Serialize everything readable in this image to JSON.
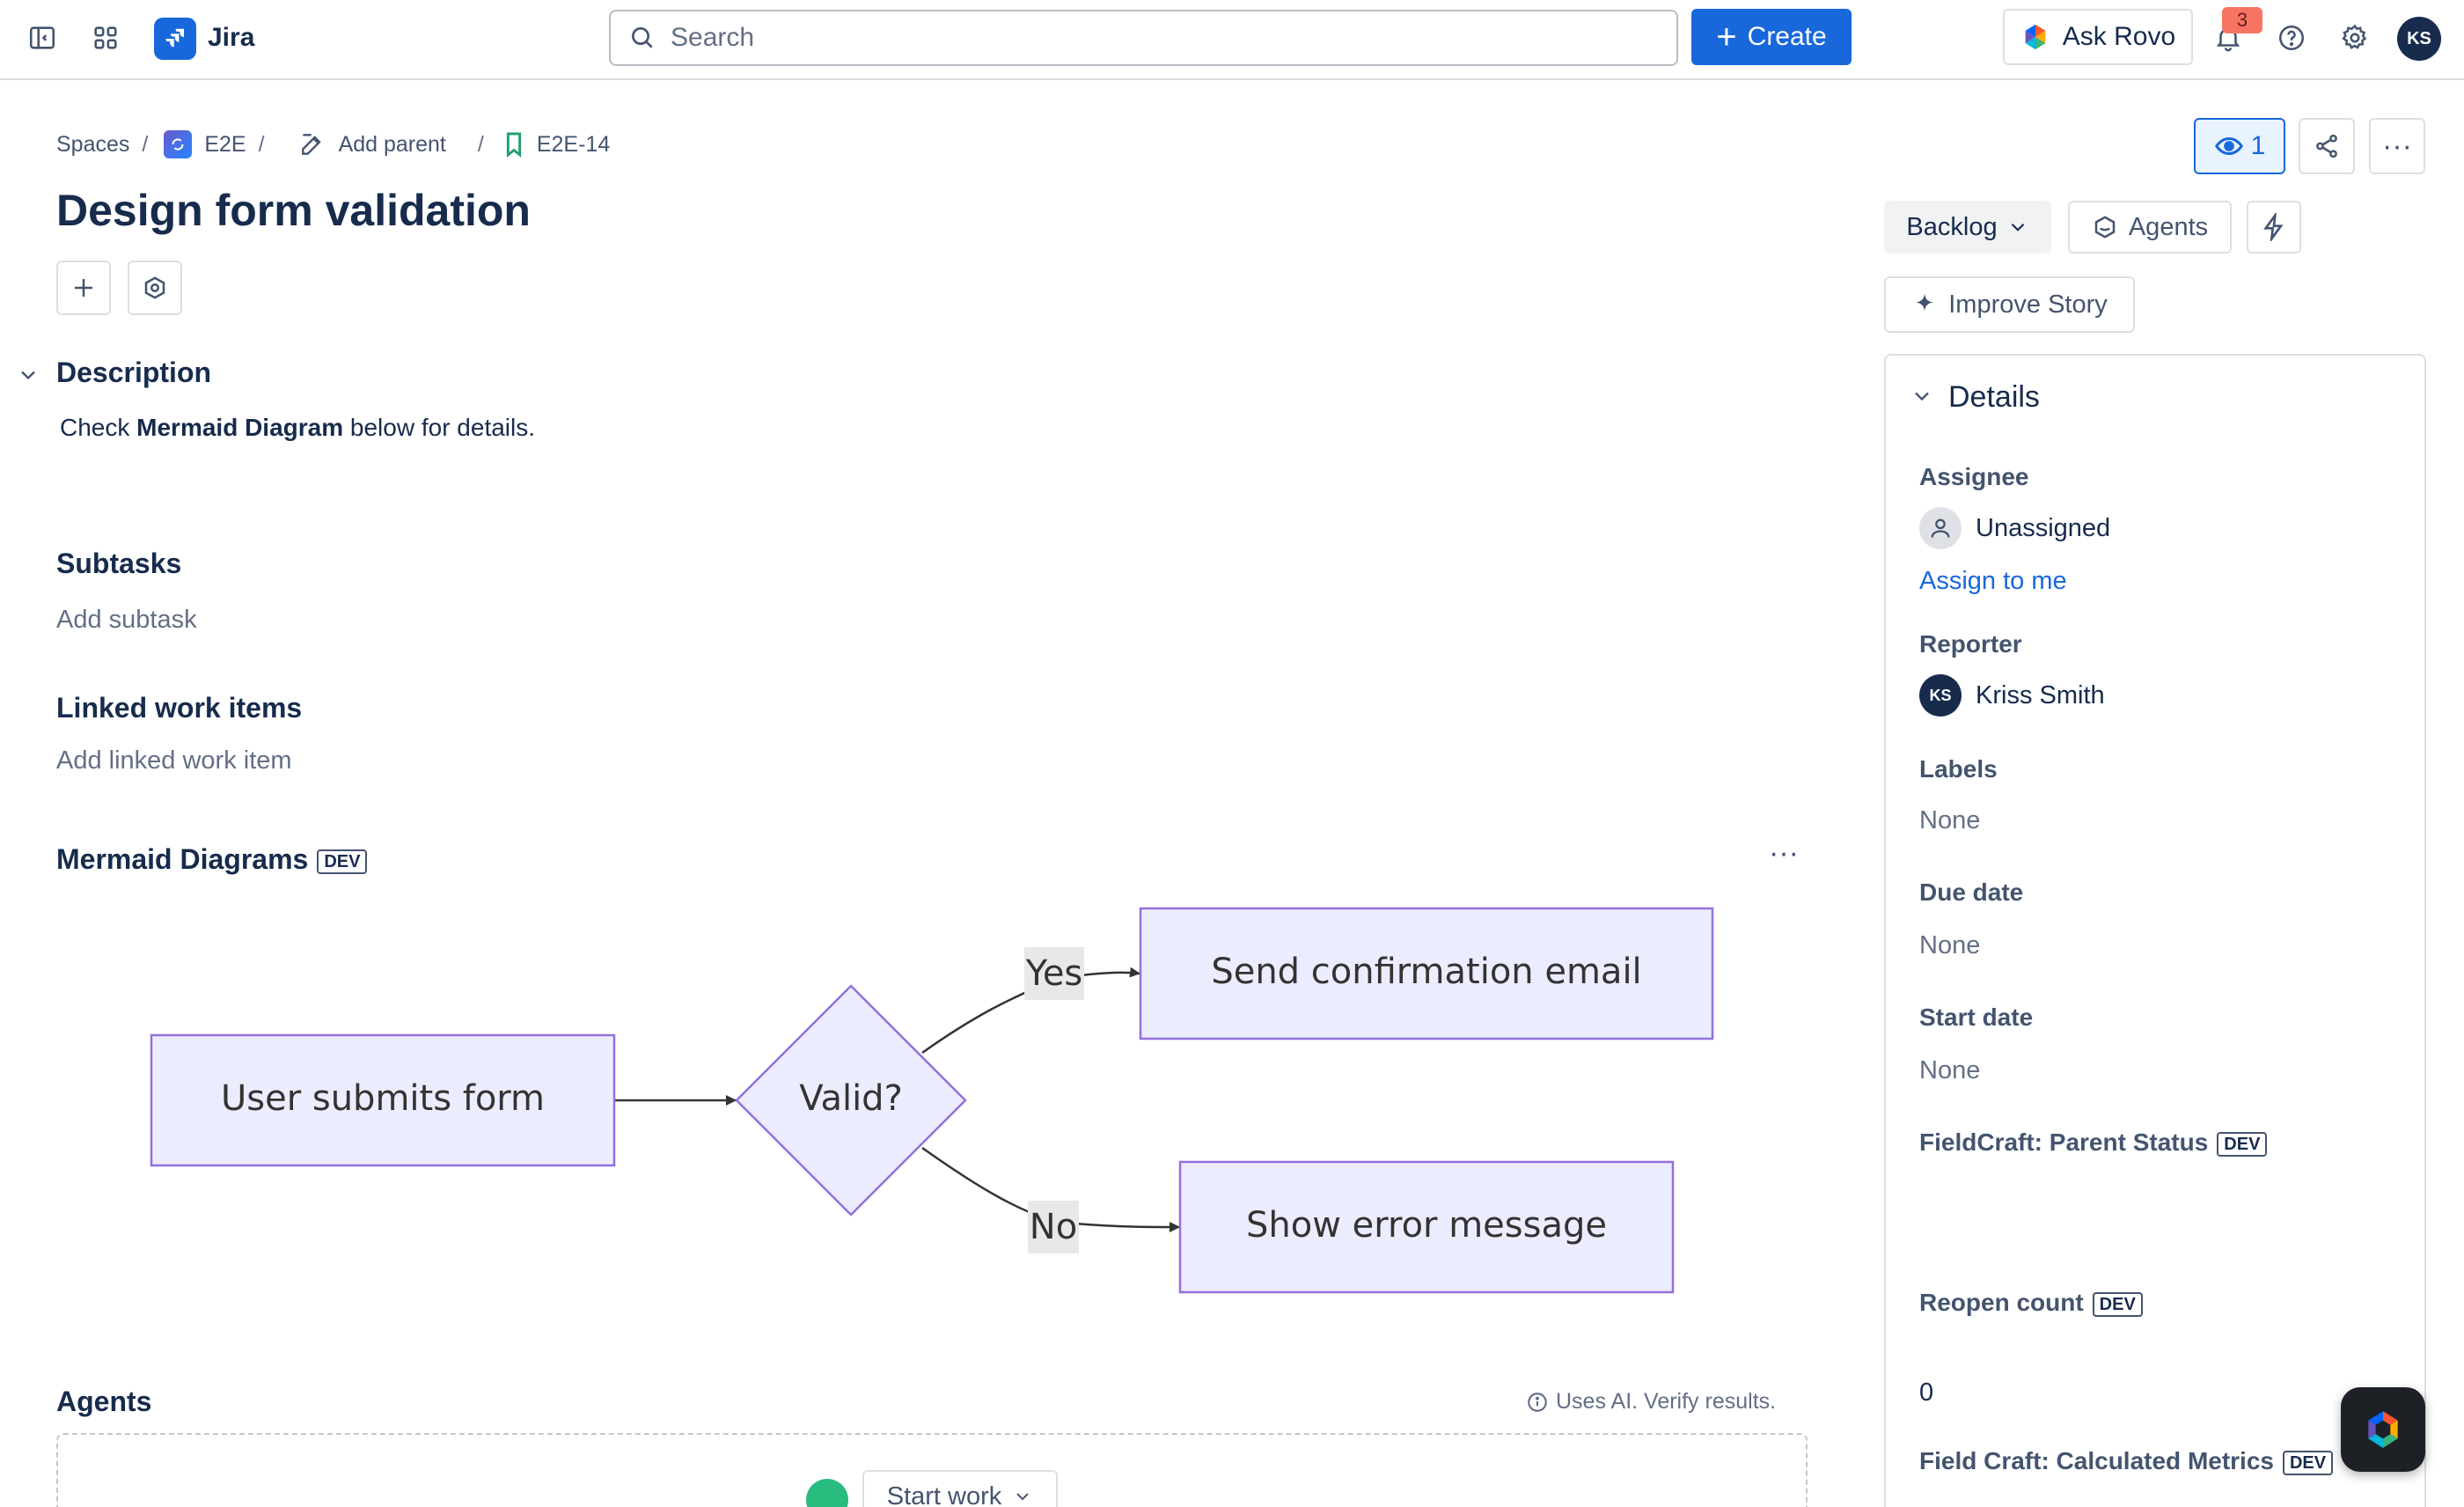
{
  "topbar": {
    "app_name": "Jira",
    "search_placeholder": "Search",
    "create_label": "Create",
    "ask_rovo_label": "Ask Rovo",
    "notification_count": "3",
    "avatar_initials": "KS"
  },
  "breadcrumb": {
    "spaces": "Spaces",
    "sep": "/",
    "space": "E2E",
    "add_parent": "Add parent",
    "issue_key": "E2E-14"
  },
  "issue": {
    "title": "Design form validation",
    "watch_count": "1",
    "more": "···"
  },
  "description": {
    "heading": "Description",
    "text_before": "Check ",
    "text_bold": "Mermaid Diagram",
    "text_after": " below for details."
  },
  "subtasks": {
    "heading": "Subtasks",
    "add": "Add subtask"
  },
  "linked": {
    "heading": "Linked work items",
    "add": "Add linked work item"
  },
  "mermaid": {
    "heading": "Mermaid Diagrams",
    "badge": "DEV",
    "more": "···",
    "nodes": {
      "start": "User submits form",
      "decision": "Valid?",
      "yes_target": "Send confirmation email",
      "no_target": "Show error message"
    },
    "edges": {
      "yes": "Yes",
      "no": "No"
    },
    "colors": {
      "node_fill": "#ececff",
      "node_stroke": "#9370db",
      "edge": "#333333",
      "label_bg": "#e8e8e8"
    }
  },
  "agents_section": {
    "heading": "Agents",
    "ai_note": "Uses AI. Verify results.",
    "start_work": "Start work"
  },
  "sidebar": {
    "status": "Backlog",
    "agents": "Agents",
    "improve": "Improve Story",
    "details_heading": "Details",
    "fields": {
      "assignee_label": "Assignee",
      "assignee_value": "Unassigned",
      "assign_to_me": "Assign to me",
      "reporter_label": "Reporter",
      "reporter_value": "Kriss Smith",
      "reporter_initials": "KS",
      "labels_label": "Labels",
      "labels_value": "None",
      "due_label": "Due date",
      "due_value": "None",
      "start_label": "Start date",
      "start_value": "None",
      "parent_status_label": "FieldCraft: Parent Status",
      "reopen_label": "Reopen count",
      "reopen_value": "0",
      "calc_label": "Field Craft: Calculated Metrics",
      "dev_badge": "DEV"
    }
  },
  "colors": {
    "brand": "#1868db",
    "text": "#172b4d",
    "muted": "#626f86",
    "border": "#dcdfe4"
  }
}
